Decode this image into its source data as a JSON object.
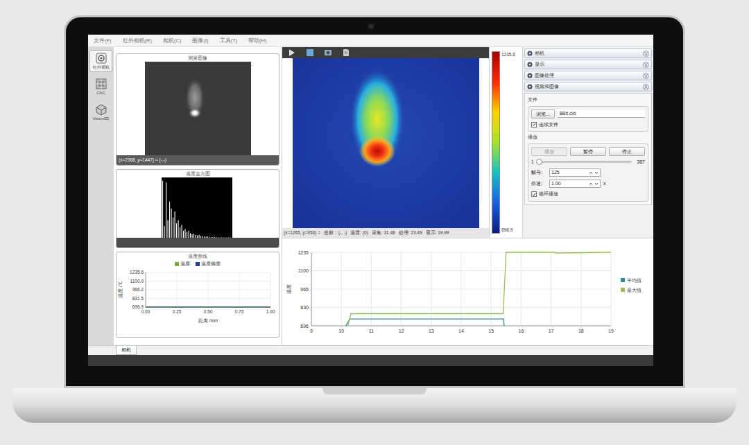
{
  "menu": [
    "文件(F)",
    "红外相机(R)",
    "相机(C)",
    "图像(I)",
    "工具(T)",
    "帮助(H)"
  ],
  "toolbar_left": [
    {
      "label": "红外相机",
      "selected": true
    },
    {
      "label": "CNC",
      "selected": false
    },
    {
      "label": "Vision3D",
      "selected": false
    }
  ],
  "measure_image": {
    "title": "测量图像",
    "coords": "(x=2368, y=1447) = (-,-)"
  },
  "histogram": {
    "title": "温度直方图",
    "bins": [
      0.98,
      0.2,
      0.95,
      0.3,
      0.62,
      0.5,
      0.35,
      0.45,
      0.25,
      0.3,
      0.18,
      0.22,
      0.12,
      0.15,
      0.1,
      0.12,
      0.08,
      0.06,
      0.07,
      0.05,
      0.04,
      0.05,
      0.03,
      0.03,
      0.02,
      0.02,
      0.02,
      0.015,
      0.01,
      0.01,
      0.01,
      0.008,
      0.006,
      0.005,
      0.004,
      0.004,
      0.003,
      0.003,
      0.002,
      0.002
    ]
  },
  "curve": {
    "title": "温度曲线",
    "y_axis_label": "温度 /℃",
    "x_axis_label": "距离 /mm",
    "y_ticks": [
      "1235.6",
      "1100.9",
      "966.2",
      "831.5",
      "696.9"
    ],
    "x_ticks": [
      "0.00",
      "0.25",
      "0.50",
      "0.75",
      "1.00"
    ],
    "series": [
      {
        "label": "温度",
        "color": "#7cab3c",
        "x": [
          0,
          1
        ],
        "values": [
          696.9,
          696.9
        ]
      },
      {
        "label": "温度梯度",
        "color": "#1f3f8f",
        "x": [
          0,
          1
        ],
        "values": [
          696.9,
          696.9
        ]
      }
    ]
  },
  "colorbar": {
    "max": "1235.6",
    "min": "696.9"
  },
  "status": {
    "prefix": "(x=1265, y=953) =",
    "items": [
      "坐标：(-, -)",
      "温度: (0)",
      "采集: 31.48",
      "处理: 23.49",
      "显示: 19.99"
    ]
  },
  "sections": [
    {
      "title": "相机",
      "expanded": false
    },
    {
      "title": "显示",
      "expanded": false
    },
    {
      "title": "图像处理",
      "expanded": false
    },
    {
      "title": "视频和图像",
      "expanded": true
    }
  ],
  "video": {
    "file_group": "文件",
    "browse_button": "浏览...",
    "file_name": "8Bit.cld",
    "continuous": {
      "label": "连续文件",
      "checked": true
    },
    "play_group": "播放",
    "buttons": [
      {
        "label": "播放",
        "disabled": true
      },
      {
        "label": "暂停",
        "disabled": false
      },
      {
        "label": "停止",
        "disabled": false
      }
    ],
    "slider": {
      "min": "1",
      "max": "387",
      "level": 0.0
    },
    "frame": {
      "label": "帧号:",
      "value": "125"
    },
    "speed": {
      "label": "倍速:",
      "value": "1.00",
      "unit": "x"
    },
    "loop": {
      "label": "循环播放",
      "checked": true
    }
  },
  "chart": {
    "y_axis_label": "温度",
    "y_ticks": [
      "1235",
      "1100",
      "965",
      "830",
      "696"
    ],
    "x_ticks": [
      "9",
      "10",
      "11",
      "12",
      "13",
      "14",
      "15",
      "16",
      "17",
      "18",
      "19"
    ],
    "series": [
      {
        "label": "平均值",
        "color": "#31859c",
        "x": [
          10.15,
          10.28,
          15.42,
          15.43
        ],
        "values": [
          696,
          746,
          746,
          696
        ]
      },
      {
        "label": "最大值",
        "color": "#9bbb59",
        "x": [
          10.22,
          10.32,
          15.4,
          15.5,
          17.1,
          17.2,
          19
        ],
        "values": [
          696,
          785,
          785,
          1235,
          1235,
          1230,
          1235
        ]
      }
    ]
  },
  "bottom_tabs": [
    {
      "label": "相机",
      "selected": true
    }
  ]
}
